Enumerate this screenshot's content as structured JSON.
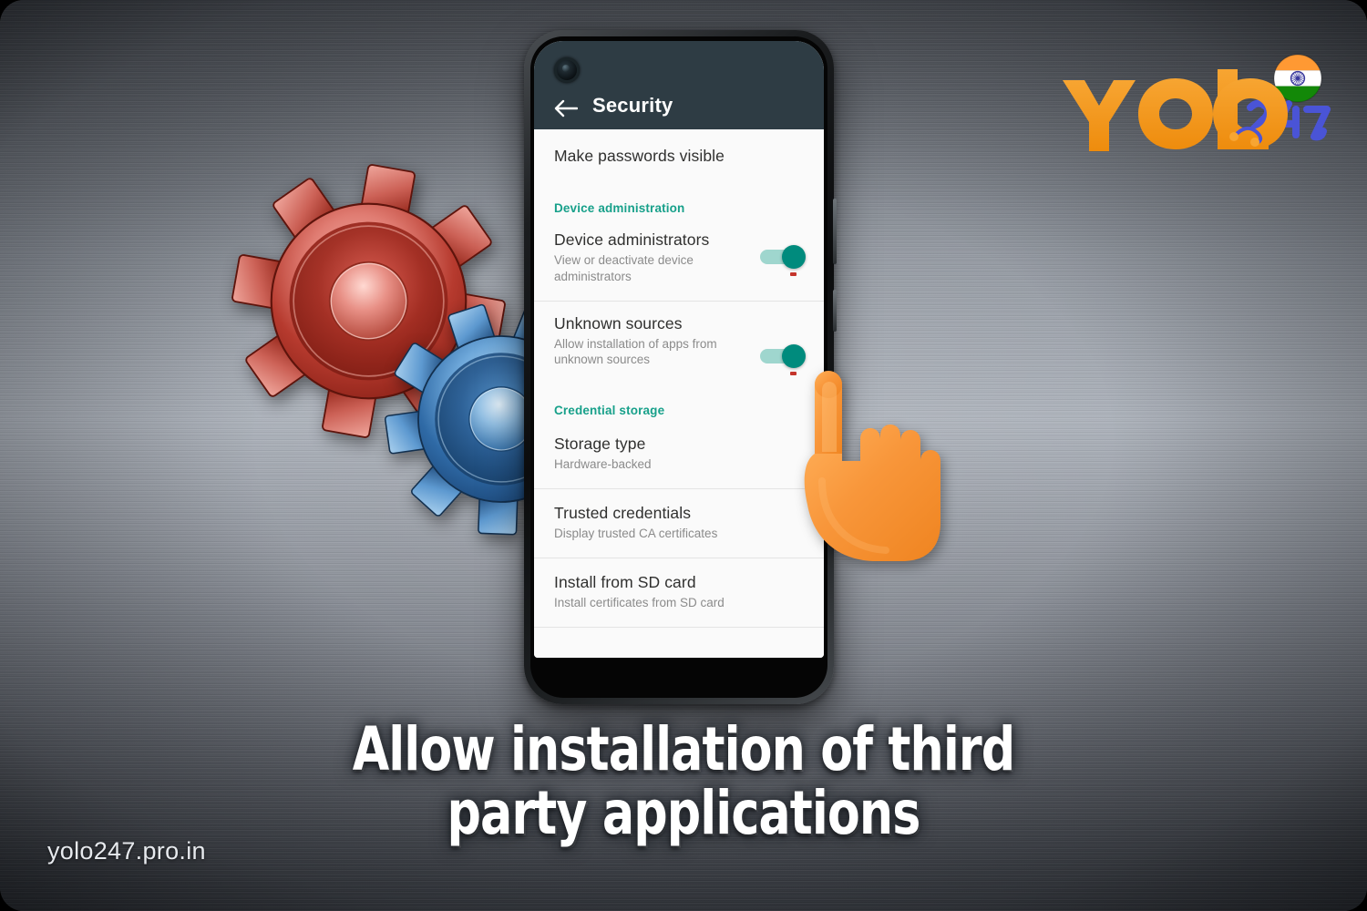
{
  "brand": {
    "logo_primary": "YOLO",
    "logo_secondary": "247",
    "logo_primary_color": "#f2941f",
    "logo_secondary_color": "#4a54d6",
    "flag_icon": "india-flag-icon"
  },
  "watermark": "yolo247.pro.in",
  "headline": {
    "line1": "Allow installation of third",
    "line2": "party applications"
  },
  "phone": {
    "appbar": {
      "back_icon": "back-arrow-icon",
      "title": "Security",
      "background_color": "#2e3c44"
    },
    "settings": [
      {
        "kind": "plain",
        "title": "Make passwords visible"
      },
      {
        "kind": "section",
        "title": "Device administration"
      },
      {
        "kind": "toggle",
        "title": "Device administrators",
        "subtitle": "View or deactivate device administrators",
        "toggle_state": "on"
      },
      {
        "kind": "toggle",
        "title": "Unknown sources",
        "subtitle": "Allow installation of apps from unknown sources",
        "toggle_state": "on"
      },
      {
        "kind": "section",
        "title": "Credential storage"
      },
      {
        "kind": "two-line",
        "title": "Storage type",
        "subtitle": "Hardware-backed"
      },
      {
        "kind": "two-line",
        "title": "Trusted credentials",
        "subtitle": "Display trusted CA certificates"
      },
      {
        "kind": "two-line",
        "title": "Install from SD card",
        "subtitle": "Install certificates from SD card"
      }
    ],
    "navbar": {
      "back": "nav-back-icon",
      "home": "nav-home-icon",
      "recents": "nav-recents-icon"
    },
    "accent_color": "#17a08a",
    "toggle_on_color": "#008b7d",
    "toggle_track_color": "#9fd6ce"
  },
  "decorations": {
    "gear_red_color": "#c0392b",
    "gear_blue_color": "#3f83c4",
    "hand_cursor_color": "#f69033"
  }
}
